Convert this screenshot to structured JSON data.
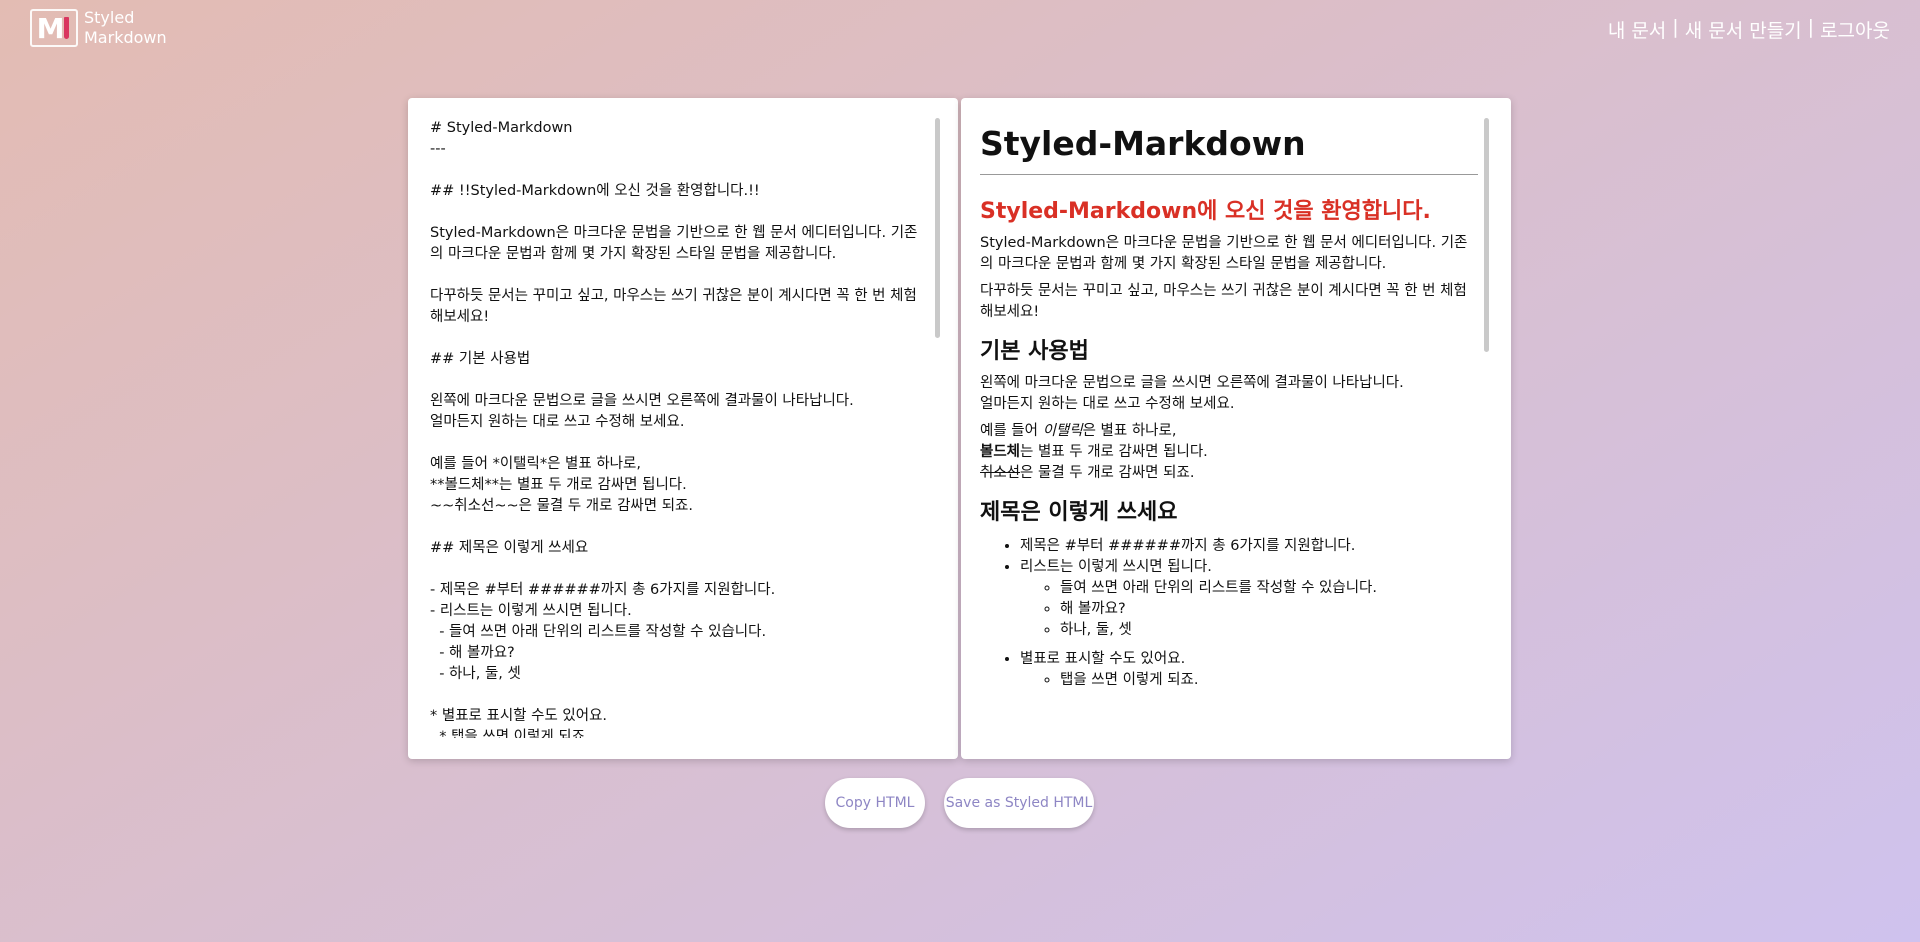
{
  "logo": {
    "mark": "M",
    "line1": "Styled",
    "line2": "Markdown"
  },
  "nav": {
    "my_docs": "내 문서",
    "sep1": "|",
    "new_doc": "새 문서 만들기",
    "sep2": "|",
    "logout": "로그아웃"
  },
  "editor": {
    "text": "# Styled-Markdown\n---\n\n## !!Styled-Markdown에 오신 것을 환영합니다.!!\n\nStyled-Markdown은 마크다운 문법을 기반으로 한 웹 문서 에디터입니다. 기존의 마크다운 문법과 함께 몇 가지 확장된 스타일 문법을 제공합니다.\n\n다꾸하듯 문서는 꾸미고 싶고, 마우스는 쓰기 귀찮은 분이 계시다면 꼭 한 번 체험해보세요!\n\n## 기본 사용법\n\n왼쪽에 마크다운 문법으로 글을 쓰시면 오른쪽에 결과물이 나타납니다.\n얼마든지 원하는 대로 쓰고 수정해 보세요.\n\n예를 들어 *이탤릭*은 별표 하나로,\n**볼드체**는 별표 두 개로 감싸면 됩니다.\n~~취소선~~은 물결 두 개로 감싸면 되죠.\n\n## 제목은 이렇게 쓰세요\n\n- 제목은 #부터 ######까지 총 6가지를 지원합니다.\n- 리스트는 이렇게 쓰시면 됩니다.\n  - 들여 쓰면 아래 단위의 리스트를 작성할 수 있습니다.\n  - 해 볼까요?\n  - 하나, 둘, 셋\n\n* 별표로 표시할 수도 있어요.\n  * 탭을 쓰면 이렇게 되죠."
  },
  "preview": {
    "h1": "Styled-Markdown",
    "welcome": "Styled-Markdown에 오신 것을 환영합니다.",
    "intro": "Styled-Markdown은 마크다운 문법을 기반으로 한 웹 문서 에디터입니다. 기존의 마크다운 문법과 함께 몇 가지 확장된 스타일 문법을 제공합니다.",
    "intro2": "다꾸하듯 문서는 꾸미고 싶고, 마우스는 쓰기 귀찮은 분이 계시다면 꼭 한 번 체험해보세요!",
    "basic_heading": "기본 사용법",
    "basic_line1": "왼쪽에 마크다운 문법으로 글을 쓰시면 오른쪽에 결과물이 나타납니다.",
    "basic_line2": "얼마든지 원하는 대로 쓰고 수정해 보세요.",
    "example_prefix": "예를 들어 ",
    "italic_word": "이탤릭",
    "italic_suffix": "은 별표 하나로,",
    "bold_word": "볼드체",
    "bold_suffix": "는 별표 두 개로 감싸면 됩니다.",
    "strike_word": "취소선",
    "strike_suffix": "은 물결 두 개로 감싸면 되죠.",
    "title_heading": "제목은 이렇게 쓰세요",
    "list1": [
      "제목은 #부터 ######까지 총 6가지를 지원합니다.",
      "리스트는 이렇게 쓰시면 됩니다."
    ],
    "sublist1": [
      "들여 쓰면 아래 단위의 리스트를 작성할 수 있습니다.",
      "해 볼까요?",
      "하나, 둘, 셋"
    ],
    "list2": [
      "별표로 표시할 수도 있어요."
    ],
    "sublist2": [
      "탭을 쓰면 이렇게 되죠."
    ]
  },
  "buttons": {
    "copy_html": "Copy HTML",
    "save_styled": "Save as Styled HTML"
  }
}
